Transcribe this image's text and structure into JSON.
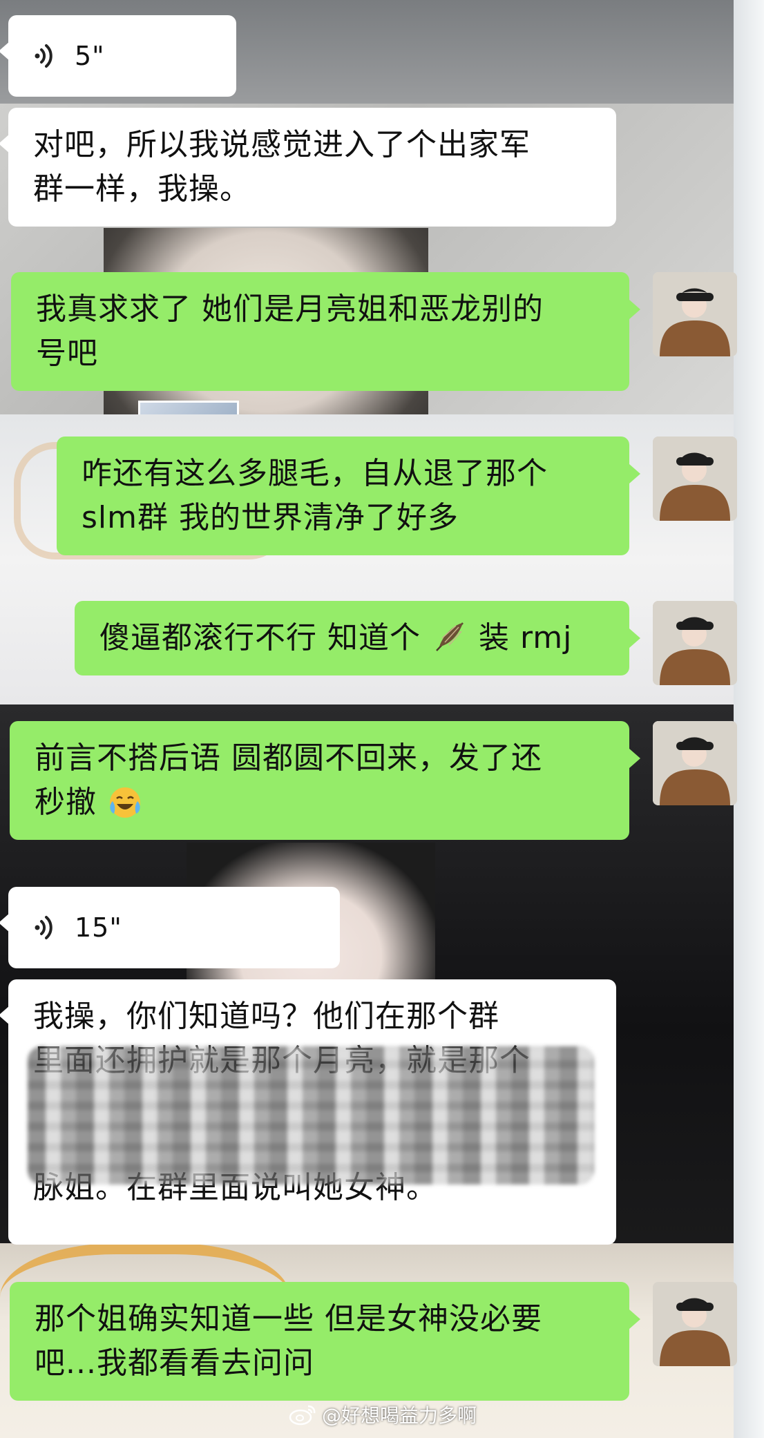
{
  "messages": [
    {
      "side": "in",
      "type": "voice",
      "duration": "5\""
    },
    {
      "side": "in",
      "type": "text",
      "lines": [
        "对吧，所以我说感觉进入了个出家军",
        "群一样，我操。"
      ]
    },
    {
      "side": "out",
      "type": "text",
      "lines": [
        "我真求求了 她们是月亮姐和恶龙别的",
        "号吧"
      ]
    },
    {
      "side": "out",
      "type": "text",
      "lines": [
        "咋还有这么多腿毛，自从退了那个",
        "slm群 我的世界清净了好多"
      ]
    },
    {
      "side": "out",
      "type": "text",
      "before": "傻逼都滚行不行 知道个",
      "after": "装 rmj",
      "icon": "feather-icon"
    },
    {
      "side": "out",
      "type": "text",
      "lines": [
        "前言不搭后语 圆都圆不回来，发了还",
        "秒撤"
      ],
      "icon": "laughing-crying-emoji"
    },
    {
      "side": "in",
      "type": "voice",
      "duration": "15\""
    },
    {
      "side": "in",
      "type": "text",
      "lines": [
        "我操，你们知道吗？他们在那个群",
        "里面还拥护就是那个月亮，就是那个",
        "脉姐。在群里面说叫她女神。"
      ]
    },
    {
      "side": "out",
      "type": "text",
      "lines": [
        "那个姐确实知道一些 但是女神没必要",
        "吧...我都看看去问问"
      ]
    }
  ],
  "watermark": "@好想喝益力多啊",
  "colors": {
    "incoming": "#ffffff",
    "outgoing": "#95ec69"
  }
}
